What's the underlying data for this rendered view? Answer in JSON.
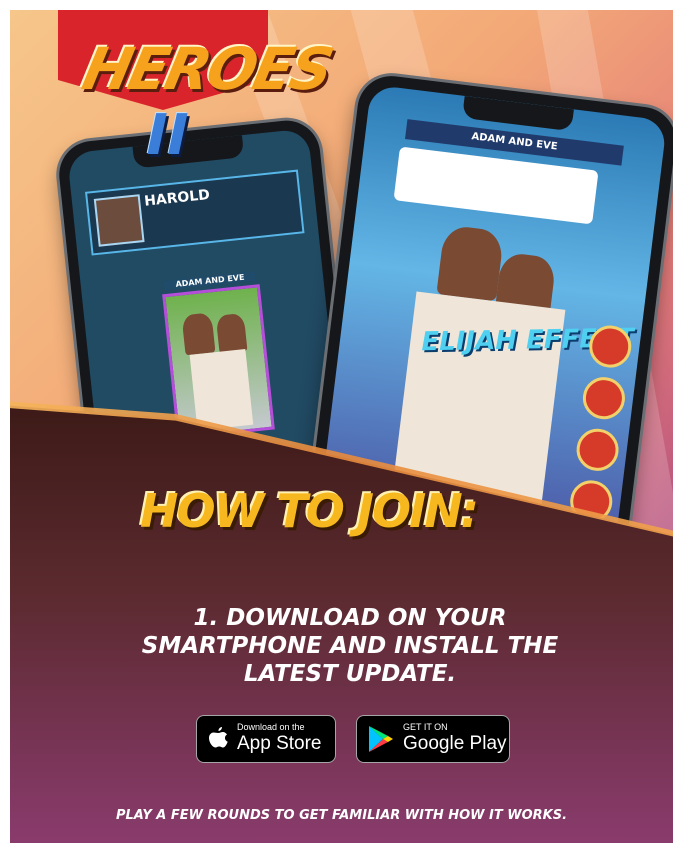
{
  "logo": {
    "title": "HEROES",
    "numeral": "II"
  },
  "left_phone": {
    "player_name": "HAROLD",
    "card_title": "ADAM AND EVE"
  },
  "right_phone": {
    "card_title": "ADAM AND EVE",
    "effect_text": "ELIJAH EFFECT"
  },
  "heading": "HOW TO JOIN:",
  "step_text": "1. DOWNLOAD ON YOUR SMARTPHONE AND INSTALL THE LATEST UPDATE.",
  "app_store": {
    "small": "Download on the",
    "big": "App Store"
  },
  "google_play": {
    "small": "GET IT ON",
    "big": "Google Play"
  },
  "footer": "PLAY A FEW ROUNDS TO GET FAMILIAR WITH HOW IT WORKS.",
  "colors": {
    "accent": "#f7b81f",
    "brand_red": "#d9242b",
    "dark_bg": "#2a1311"
  }
}
